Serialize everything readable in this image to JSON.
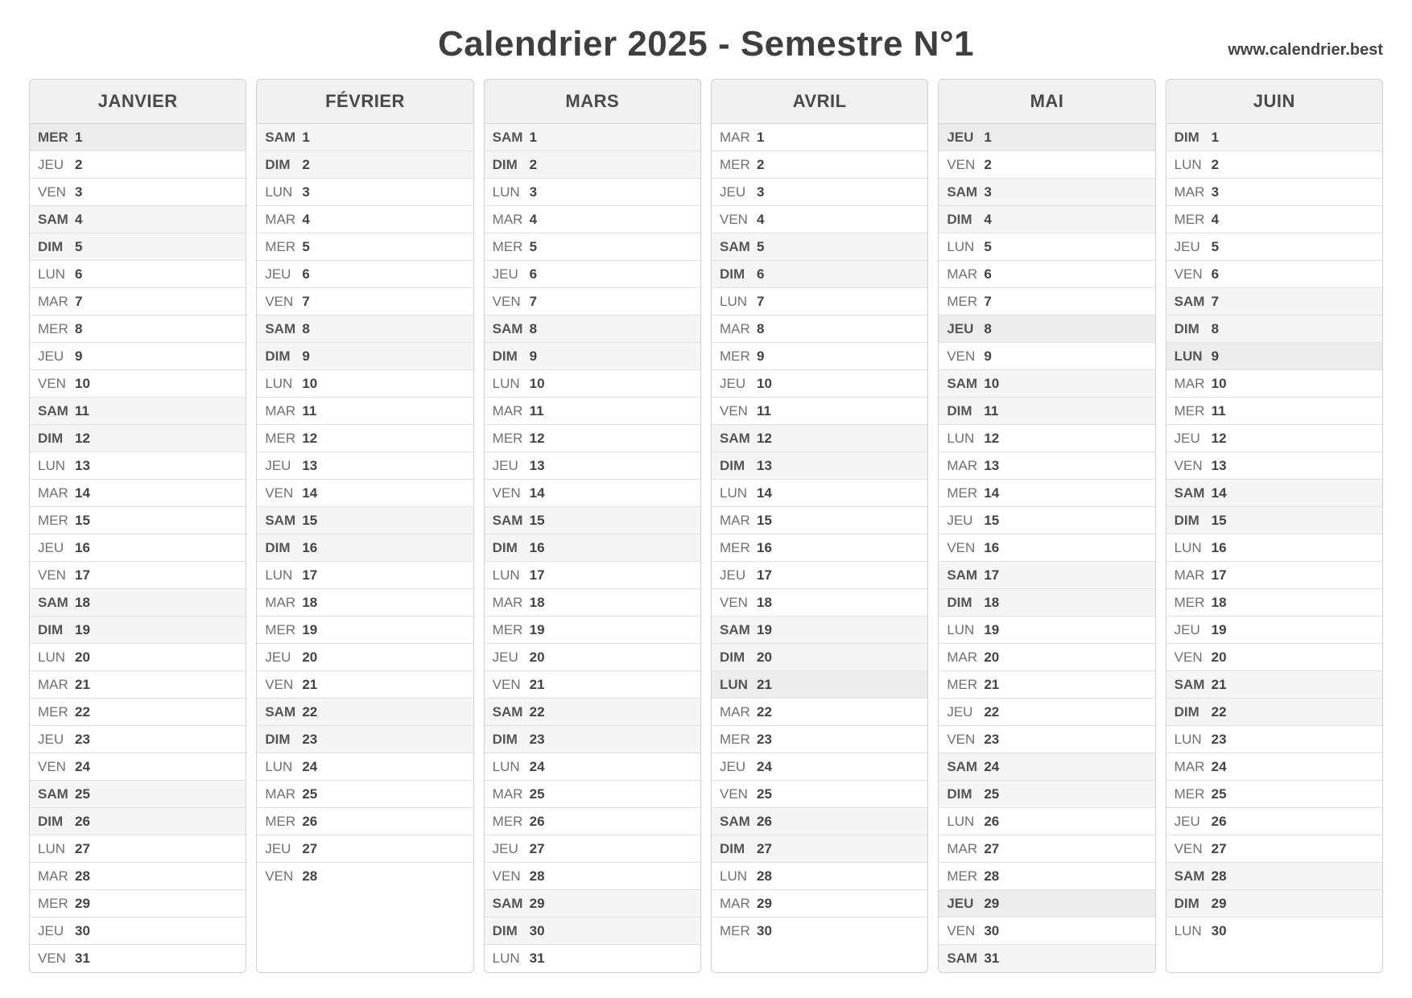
{
  "title": "Calendrier 2025 - Semestre N°1",
  "site": "www.calendrier.best",
  "day_abbr": [
    "LUN",
    "MAR",
    "MER",
    "JEU",
    "VEN",
    "SAM",
    "DIM"
  ],
  "months": [
    {
      "name": "JANVIER",
      "days_in_month": 31,
      "first_weekday": 2,
      "holidays": [
        1
      ]
    },
    {
      "name": "FÉVRIER",
      "days_in_month": 28,
      "first_weekday": 5,
      "holidays": []
    },
    {
      "name": "MARS",
      "days_in_month": 31,
      "first_weekday": 5,
      "holidays": []
    },
    {
      "name": "AVRIL",
      "days_in_month": 30,
      "first_weekday": 1,
      "holidays": [
        21
      ]
    },
    {
      "name": "MAI",
      "days_in_month": 31,
      "first_weekday": 3,
      "holidays": [
        1,
        8,
        29
      ]
    },
    {
      "name": "JUIN",
      "days_in_month": 30,
      "first_weekday": 6,
      "holidays": [
        9
      ]
    }
  ]
}
